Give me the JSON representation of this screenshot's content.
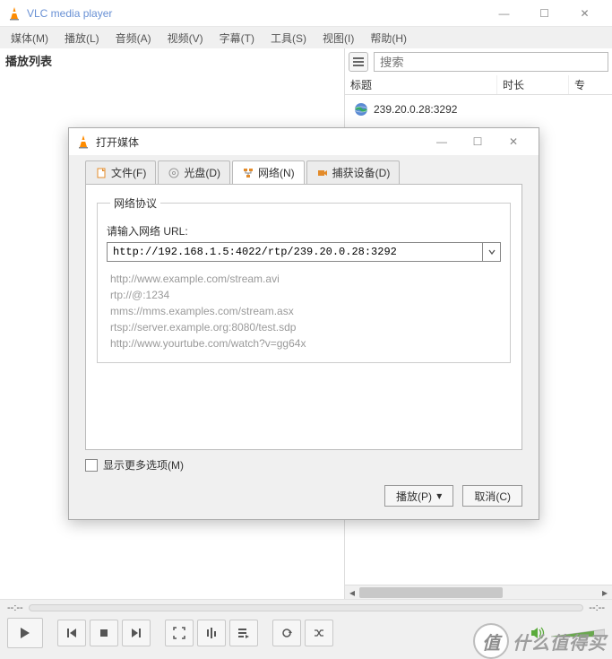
{
  "window": {
    "title": "VLC media player",
    "controls": {
      "min": "—",
      "max": "☐",
      "close": "✕"
    }
  },
  "menubar": [
    "媒体(M)",
    "播放(L)",
    "音频(A)",
    "视频(V)",
    "字幕(T)",
    "工具(S)",
    "视图(I)",
    "帮助(H)"
  ],
  "playlist": {
    "title": "播放列表"
  },
  "search": {
    "placeholder": "搜索"
  },
  "list": {
    "headers": [
      "标题",
      "时长",
      "专"
    ],
    "items": [
      {
        "label": "239.20.0.28:3292"
      }
    ]
  },
  "seek": {
    "left": "--:--",
    "right": "--:--"
  },
  "dialog": {
    "title": "打开媒体",
    "tabs": [
      {
        "icon": "file-icon",
        "label": "文件(F)"
      },
      {
        "icon": "disc-icon",
        "label": "光盘(D)"
      },
      {
        "icon": "network-icon",
        "label": "网络(N)"
      },
      {
        "icon": "capture-icon",
        "label": "捕获设备(D)"
      }
    ],
    "active_tab": 2,
    "group_title": "网络协议",
    "prompt": "请输入网络 URL:",
    "url": "http://192.168.1.5:4022/rtp/239.20.0.28:3292",
    "examples": [
      "http://www.example.com/stream.avi",
      "rtp://@:1234",
      "mms://mms.examples.com/stream.asx",
      "rtsp://server.example.org:8080/test.sdp",
      "http://www.yourtube.com/watch?v=gg64x"
    ],
    "more_options": "显示更多选项(M)",
    "play": "播放(P)",
    "cancel": "取消(C)"
  },
  "watermark": {
    "logo": "值",
    "text": "什么值得买"
  }
}
